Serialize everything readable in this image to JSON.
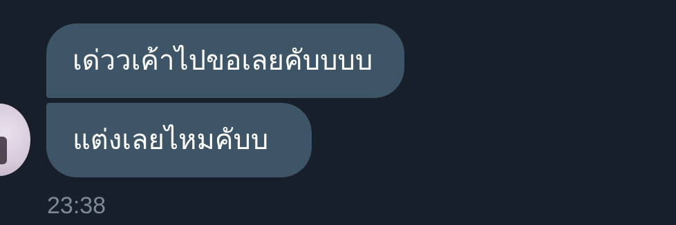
{
  "messages": [
    {
      "text": "เด่ววเค้าไปขอเลยคับบบบ"
    },
    {
      "text": "แต่งเลยไหมคับบ"
    }
  ],
  "timestamp": "23:38",
  "colors": {
    "background": "#17202a",
    "bubble": "#3e5567",
    "text": "#ffffff",
    "timestamp": "#7d8a96"
  }
}
